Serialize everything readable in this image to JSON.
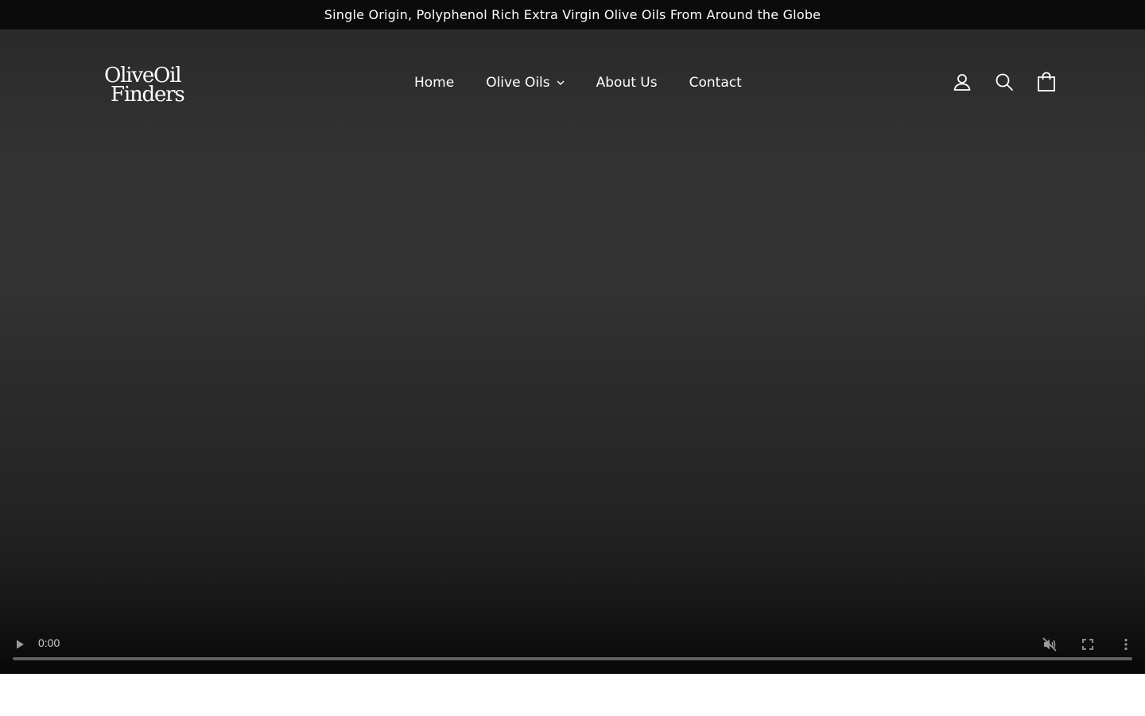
{
  "announcement": {
    "text": "Single Origin, Polyphenol Rich Extra Virgin Olive Oils From Around the Globe"
  },
  "logo": {
    "line1": "OliveOil",
    "line2": "Finders"
  },
  "nav": {
    "items": [
      {
        "label": "Home"
      },
      {
        "label": "Olive Oils",
        "has_dropdown": true
      },
      {
        "label": "About Us"
      },
      {
        "label": "Contact"
      }
    ]
  },
  "header_icons": [
    "account-icon",
    "search-icon",
    "cart-bag-icon"
  ],
  "video": {
    "time": "0:00",
    "progress": 0,
    "muted": true,
    "icons": [
      "play-icon",
      "muted-speaker-icon",
      "fullscreen-icon",
      "more-vertical-icon"
    ]
  },
  "colors": {
    "announcement_bg": "#0b0b0b",
    "hero_bg": "#333333",
    "text": "#ffffff"
  }
}
